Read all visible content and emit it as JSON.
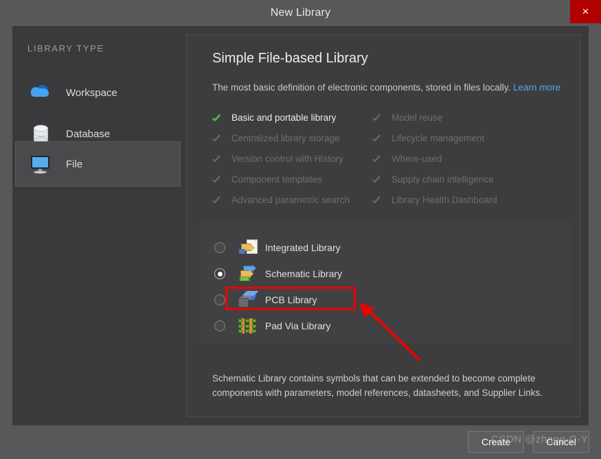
{
  "window": {
    "title": "New Library",
    "close_label": "×"
  },
  "sidebar": {
    "header": "LIBRARY TYPE",
    "items": [
      {
        "label": "Workspace",
        "icon": "cloud-icon",
        "selected": false
      },
      {
        "label": "Database",
        "icon": "database-icon",
        "selected": false
      },
      {
        "label": "File",
        "icon": "monitor-icon",
        "selected": true
      }
    ]
  },
  "main": {
    "title": "Simple File-based Library",
    "description": "The most basic definition of electronic components, stored in files locally.",
    "learn_more": "Learn more",
    "features_left": [
      {
        "label": "Basic and portable library",
        "enabled": true
      },
      {
        "label": "Centralized library storage",
        "enabled": false
      },
      {
        "label": "Version control with History",
        "enabled": false
      },
      {
        "label": "Component templates",
        "enabled": false
      },
      {
        "label": "Advanced parametric search",
        "enabled": false
      }
    ],
    "features_right": [
      {
        "label": "Model reuse",
        "enabled": false
      },
      {
        "label": "Lifecycle management",
        "enabled": false
      },
      {
        "label": "Where-used",
        "enabled": false
      },
      {
        "label": "Supply chain intelligence",
        "enabled": false
      },
      {
        "label": "Library Health Dashboard",
        "enabled": false
      }
    ],
    "library_options": [
      {
        "label": "Integrated Library",
        "icon": "integrated-library-icon",
        "selected": false
      },
      {
        "label": "Schematic Library",
        "icon": "schematic-library-icon",
        "selected": true
      },
      {
        "label": "PCB Library",
        "icon": "pcb-library-icon",
        "selected": false
      },
      {
        "label": "Pad Via Library",
        "icon": "pad-via-library-icon",
        "selected": false
      }
    ],
    "option_description": "Schematic Library contains symbols that can be extended to become complete components with parameters, model references, datasheets, and Supplier Links."
  },
  "footer": {
    "create_label": "Create",
    "cancel_label": "Cancel"
  },
  "watermark": "CSDN @zhang-C-Y",
  "colors": {
    "accent_link": "#55a8e8",
    "check_active": "#4caf50",
    "close_button": "#b00000",
    "annotation": "#ee0000",
    "dialog_bg": "#58585a",
    "panel_bg": "#3d3d3f"
  }
}
